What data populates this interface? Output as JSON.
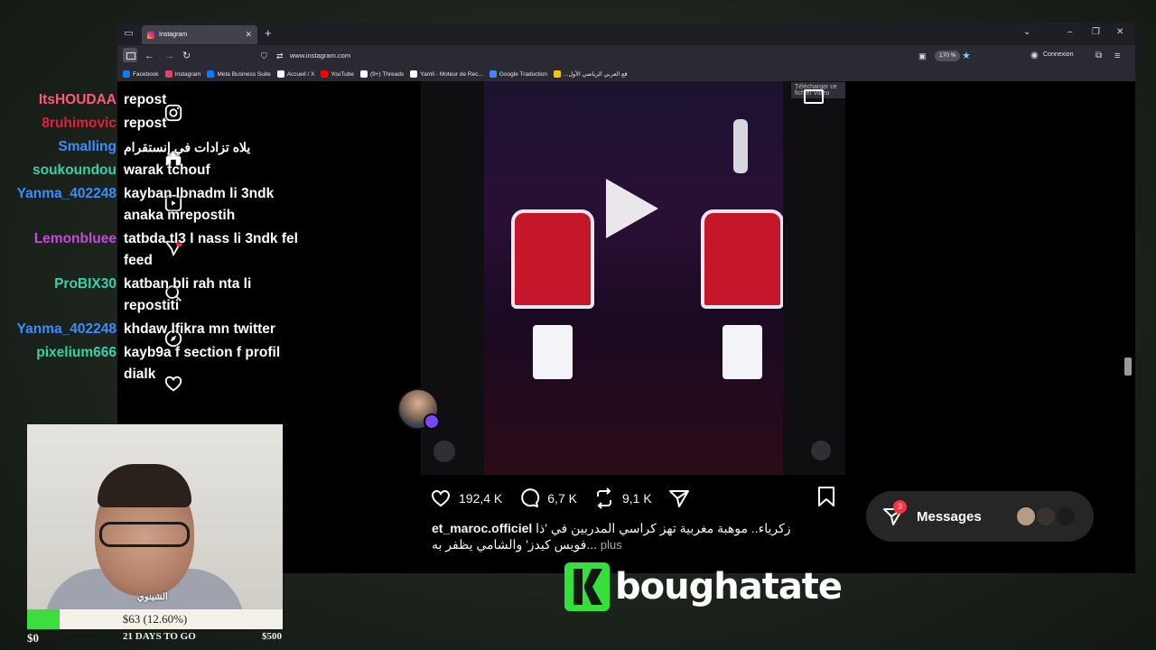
{
  "browser": {
    "tab_title": "Instagram",
    "url": "www.instagram.com",
    "zoom": "170 %",
    "connexion_label": "Connexion",
    "bookmarks": [
      {
        "label": "Facebook",
        "color": "#1877f2"
      },
      {
        "label": "Instagram",
        "color": "#e4405f"
      },
      {
        "label": "Meta Business Suite",
        "color": "#0a7cff"
      },
      {
        "label": "Accueil / X",
        "color": "#ffffff"
      },
      {
        "label": "YouTube",
        "color": "#ff0000"
      },
      {
        "label": "(9+) Threads",
        "color": "#ffffff"
      },
      {
        "label": "Yamli - Moteur de Rec...",
        "color": "#ffffff"
      },
      {
        "label": "Google Traduction",
        "color": "#4285f4"
      },
      {
        "label": "...قع العربي الرياضي الأول",
        "color": "#f7c600"
      }
    ]
  },
  "video": {
    "download_strip": "Télécharger ce fichier Vidéo"
  },
  "post": {
    "likes": "192,4 K",
    "comments": "6,7 K",
    "reposts": "9,1 K",
    "caption_user": "et_maroc.officiel",
    "caption_text": "زكرياء.. موهبة مغربية تهز كراسي المدربين في 'ذا فويس كيدز' والشامي يظفر به...",
    "more_label": "plus"
  },
  "messages": {
    "label": "Messages",
    "badge": "3"
  },
  "chat": [
    {
      "user": "ItsHOUDAA",
      "color": "#ff5a7a",
      "msg": "repost"
    },
    {
      "user": "8ruhimovic",
      "color": "#e0203a",
      "msg": "repost"
    },
    {
      "user": "Smalling",
      "color": "#3a8cff",
      "msg": "يلاه تزادات في إنستقرام"
    },
    {
      "user": "soukoundou",
      "color": "#3bd1a8",
      "msg": "warak tchouf"
    },
    {
      "user": "Yanma_402248",
      "color": "#3a8cff",
      "msg": "kayban lbnadm li 3ndk anaka mrepostih"
    },
    {
      "user": "Lemonbluee",
      "color": "#c44bd8",
      "msg": "tatbda tl3 l nass li 3ndk fel feed"
    },
    {
      "user": "ProBIX30",
      "color": "#3bd1a8",
      "msg": "katban bli rah nta li repostiti"
    },
    {
      "user": "Yanma_402248",
      "color": "#3a8cff",
      "msg": "khdaw lfikra mn twitter"
    },
    {
      "user": "pixelium666",
      "color": "#3bd1a8",
      "msg": "kayb9a f section f profil dialk"
    }
  ],
  "webcam": {
    "name_overlay": "الشينوي"
  },
  "donation": {
    "amount_label": "$63 (12.60%)",
    "percent": 12.6,
    "start": "$0",
    "days_left": "21 DAYS TO GO",
    "goal": "$500"
  },
  "brand": {
    "name": "boughatate",
    "accent": "#35e03a"
  }
}
